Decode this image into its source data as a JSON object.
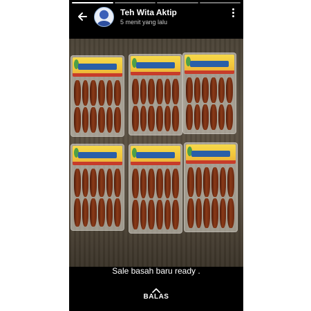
{
  "status": {
    "segments": 4,
    "active_segment": 1
  },
  "header": {
    "name": "Teh Wita Aktip",
    "time": "5 menit yang lalu",
    "back_icon": "arrow-back-icon",
    "menu_icon": "more-vertical-icon"
  },
  "photo": {
    "subject": "product-photo",
    "packs_per_row": 3,
    "rows": 2
  },
  "caption": "Sale basah baru ready .",
  "reply": {
    "label": "BALAS",
    "icon": "chevron-up-icon"
  },
  "colors": {
    "background": "#000000",
    "text": "#ffffff",
    "label_yellow": "#f2c43a"
  }
}
